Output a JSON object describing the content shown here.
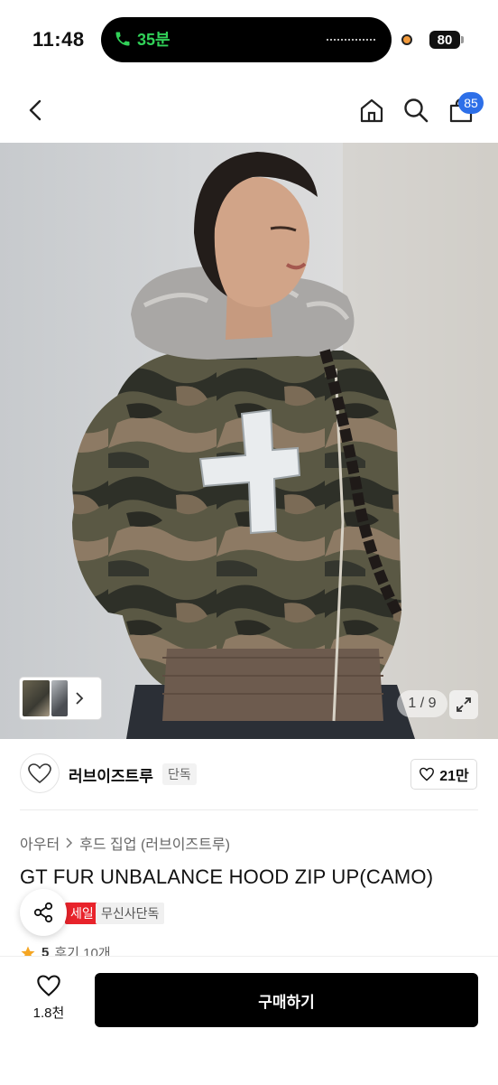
{
  "status": {
    "time": "11:48",
    "call": "35분",
    "battery": "80"
  },
  "nav": {
    "cart_count": "85",
    "icons": [
      "back-icon",
      "home-icon",
      "search-icon",
      "cart-icon"
    ]
  },
  "gallery": {
    "counter": "1 / 9"
  },
  "brand": {
    "name": "러브이즈트루",
    "exclusive_tag": "단독",
    "likes": "21만"
  },
  "breadcrumb": [
    "아우터",
    "후드 집업 (러브이즈트루)"
  ],
  "product": {
    "title": "GT FUR UNBALANCE HOOD ZIP UP(CAMO)",
    "tags": [
      "세일",
      "무신사단독"
    ],
    "tag_red_visible": "세일",
    "rating": "5",
    "reviews": "후기 10개"
  },
  "bottom": {
    "wish_count": "1.8천",
    "buy_label": "구매하기"
  },
  "colors": {
    "accent_blue": "#2d6fe8",
    "sale_red": "#e8232b",
    "call_green": "#31d158",
    "star": "#f5a623"
  }
}
